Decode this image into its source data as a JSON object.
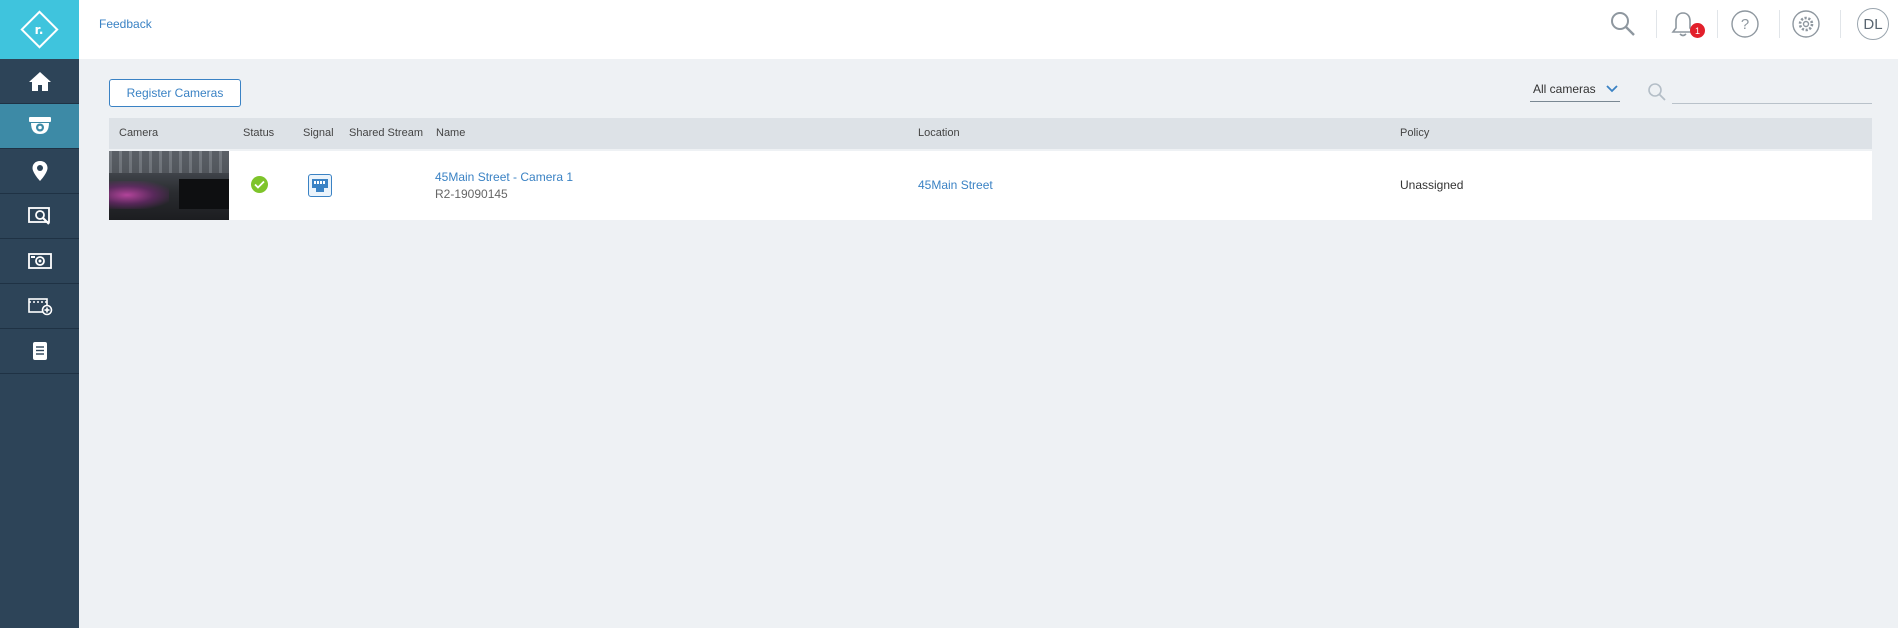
{
  "app": {
    "logo_text": "r."
  },
  "sidebar": {
    "items": [
      {
        "icon": "home-icon"
      },
      {
        "icon": "camera-icon",
        "active": true
      },
      {
        "icon": "location-pin-icon"
      },
      {
        "icon": "search-footage-icon"
      },
      {
        "icon": "video-wall-icon"
      },
      {
        "icon": "clip-add-icon"
      },
      {
        "icon": "document-icon"
      }
    ]
  },
  "header": {
    "feedback_label": "Feedback",
    "notifications_count": "1",
    "avatar_initials": "DL"
  },
  "toolbar": {
    "register_label": "Register Cameras",
    "filter_value": "All cameras",
    "search_placeholder": ""
  },
  "table": {
    "columns": [
      "Camera",
      "Status",
      "Signal",
      "Shared Stream",
      "Name",
      "Location",
      "Policy"
    ],
    "rows": [
      {
        "name": "45Main Street - Camera 1",
        "id": "R2-19090145",
        "location": "45Main Street",
        "policy": "Unassigned",
        "status": "online",
        "signal": "ethernet"
      }
    ]
  },
  "colors": {
    "sidebar_bg": "#2d4458",
    "logo_bg": "#3fc4dd",
    "active_nav": "#3d8aa6",
    "accent": "#3a82c4",
    "status_ok": "#7ec42a",
    "badge": "#e2202b"
  }
}
